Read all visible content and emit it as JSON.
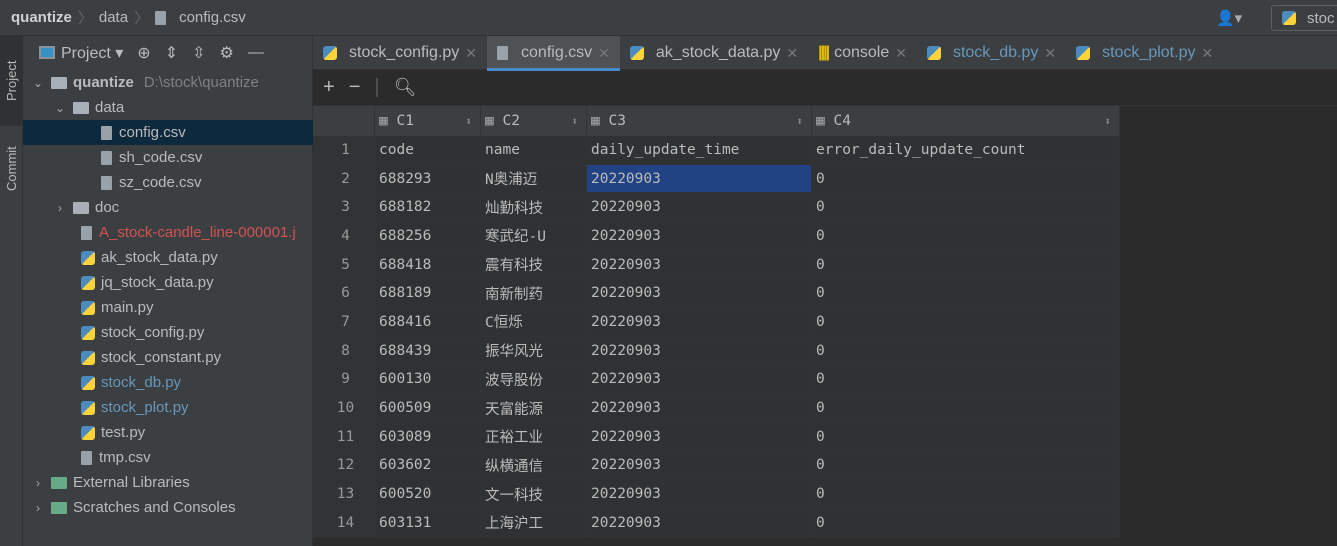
{
  "breadcrumb": [
    "quantize",
    "data",
    "config.csv"
  ],
  "top_right": "stoc",
  "side_tabs": [
    "Project",
    "Commit"
  ],
  "panel": {
    "title": "Project"
  },
  "tree": [
    {
      "label": "quantize",
      "extra": "D:\\stock\\quantize",
      "type": "folder",
      "level": 0,
      "open": true
    },
    {
      "label": "data",
      "type": "folder",
      "level": 1,
      "open": true
    },
    {
      "label": "config.csv",
      "type": "file",
      "level": 2,
      "selected": true
    },
    {
      "label": "sh_code.csv",
      "type": "file",
      "level": 2
    },
    {
      "label": "sz_code.csv",
      "type": "file",
      "level": 2
    },
    {
      "label": "doc",
      "type": "folder",
      "level": 1,
      "open": false
    },
    {
      "label": "A_stock-candle_line-000001.j",
      "type": "file",
      "level": 1,
      "color": "#d25252"
    },
    {
      "label": "ak_stock_data.py",
      "type": "py",
      "level": 1
    },
    {
      "label": "jq_stock_data.py",
      "type": "py",
      "level": 1
    },
    {
      "label": "main.py",
      "type": "py",
      "level": 1
    },
    {
      "label": "stock_config.py",
      "type": "py",
      "level": 1
    },
    {
      "label": "stock_constant.py",
      "type": "py",
      "level": 1
    },
    {
      "label": "stock_db.py",
      "type": "py",
      "level": 1,
      "color": "#6897bb"
    },
    {
      "label": "stock_plot.py",
      "type": "py",
      "level": 1,
      "color": "#6897bb"
    },
    {
      "label": "test.py",
      "type": "py",
      "level": 1
    },
    {
      "label": "tmp.csv",
      "type": "file",
      "level": 1
    },
    {
      "label": "External Libraries",
      "type": "lib",
      "level": 0,
      "open": false
    },
    {
      "label": "Scratches and Consoles",
      "type": "lib",
      "level": 0,
      "open": false
    }
  ],
  "tabs": [
    {
      "label": "stock_config.py",
      "icon": "py"
    },
    {
      "label": "config.csv",
      "icon": "file",
      "active": true
    },
    {
      "label": "ak_stock_data.py",
      "icon": "py"
    },
    {
      "label": "console",
      "icon": "console"
    },
    {
      "label": "stock_db.py",
      "icon": "py",
      "color": "#6897bb"
    },
    {
      "label": "stock_plot.py",
      "icon": "py",
      "color": "#6897bb"
    }
  ],
  "columns": [
    "C1",
    "C2",
    "C3",
    "C4"
  ],
  "rows": [
    [
      "1",
      "code",
      "name",
      "daily_update_time",
      "error_daily_update_count"
    ],
    [
      "2",
      "688293",
      "N奥浦迈",
      "20220903",
      "0"
    ],
    [
      "3",
      "688182",
      "灿勤科技",
      "20220903",
      "0"
    ],
    [
      "4",
      "688256",
      "寒武纪-U",
      "20220903",
      "0"
    ],
    [
      "5",
      "688418",
      "震有科技",
      "20220903",
      "0"
    ],
    [
      "6",
      "688189",
      "南新制药",
      "20220903",
      "0"
    ],
    [
      "7",
      "688416",
      "C恒烁",
      "20220903",
      "0"
    ],
    [
      "8",
      "688439",
      "振华风光",
      "20220903",
      "0"
    ],
    [
      "9",
      "600130",
      "波导股份",
      "20220903",
      "0"
    ],
    [
      "10",
      "600509",
      "天富能源",
      "20220903",
      "0"
    ],
    [
      "11",
      "603089",
      "正裕工业",
      "20220903",
      "0"
    ],
    [
      "12",
      "603602",
      "纵横通信",
      "20220903",
      "0"
    ],
    [
      "13",
      "600520",
      "文一科技",
      "20220903",
      "0"
    ],
    [
      "14",
      "603131",
      "上海沪工",
      "20220903",
      "0"
    ]
  ]
}
